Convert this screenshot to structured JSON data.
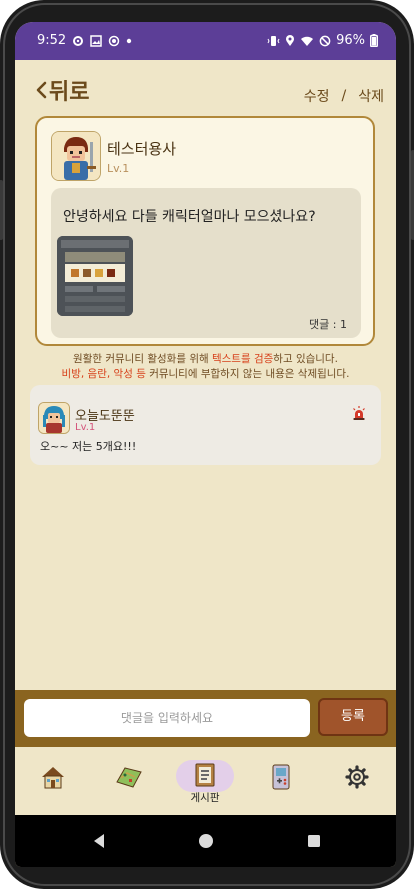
{
  "status_bar": {
    "time": "9:52",
    "battery": "96%",
    "left_icons": [
      "settings-icon",
      "image-icon",
      "record-icon",
      "dot-icon"
    ],
    "right_icons": [
      "vibrate-icon",
      "location-icon",
      "wifi-icon",
      "do-not-disturb-icon",
      "battery-icon"
    ]
  },
  "header": {
    "back_label": "뒤로",
    "edit_label": "수정",
    "separator": "/",
    "delete_label": "삭제"
  },
  "post": {
    "author": "테스터용사",
    "level": "Lv.1",
    "title": "안녕하세요 다들 캐릭터얼마나 모으셨나요?",
    "comment_count_label": "댓글 : 1"
  },
  "notice": {
    "line1_a": "원활한 커뮤니티 활성화를 위해 ",
    "line1_highlight": "텍스트를 검증",
    "line1_b": "하고 있습니다.",
    "line2_highlight": "비방, 음란, 악성 등",
    "line2_rest": " 커뮤니티에 부합하지 않는 내용은 삭제됩니다."
  },
  "comments": [
    {
      "author": "오늘도뚠뚠",
      "level": "Lv.1",
      "text": "오~~ 저는 5개요!!!"
    }
  ],
  "comment_input": {
    "placeholder": "댓글을 입력하세요",
    "submit_label": "등록"
  },
  "bottom_nav": [
    {
      "icon": "house-icon",
      "label": ""
    },
    {
      "icon": "map-icon",
      "label": ""
    },
    {
      "icon": "board-icon",
      "label": "게시판",
      "active": true
    },
    {
      "icon": "game-console-icon",
      "label": ""
    },
    {
      "icon": "gear-icon",
      "label": ""
    }
  ],
  "colors": {
    "status_bar": "#5c3e97",
    "background": "#efe6c8",
    "accent_brown": "#6b4a1b",
    "card_border": "#b1883a",
    "highlight_red": "#d7401a",
    "submit_button": "#a0542b",
    "input_bar": "#8a6420"
  }
}
